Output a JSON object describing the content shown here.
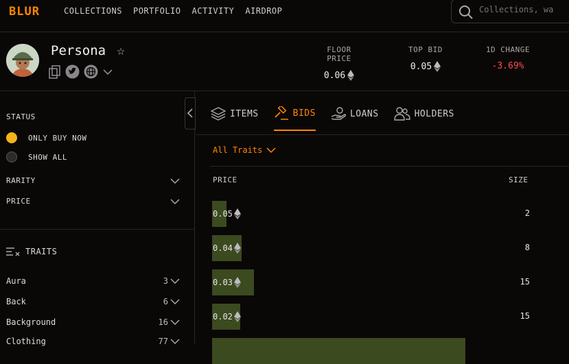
{
  "brand": {
    "logo": "BLUR",
    "accent": "#ff8700"
  },
  "nav": [
    "COLLECTIONS",
    "PORTFOLIO",
    "ACTIVITY",
    "AIRDROP"
  ],
  "search": {
    "placeholder": "Collections, wa"
  },
  "collection": {
    "name": "Persona",
    "stats": [
      {
        "label": "FLOOR PRICE",
        "value": "0.06"
      },
      {
        "label": "TOP BID",
        "value": "0.05"
      },
      {
        "label": "1D CHANGE",
        "value": "-3.69%"
      }
    ]
  },
  "sidebar": {
    "status_title": "STATUS",
    "status_options": [
      {
        "label": "ONLY BUY NOW",
        "selected": true
      },
      {
        "label": "SHOW ALL",
        "selected": false
      }
    ],
    "rarity": "RARITY",
    "price": "PRICE",
    "traits_title": "TRAITS",
    "traits": [
      {
        "label": "Aura",
        "count": "3"
      },
      {
        "label": "Back",
        "count": "6"
      },
      {
        "label": "Background",
        "count": "16"
      },
      {
        "label": "Clothing",
        "count": "77"
      }
    ]
  },
  "tabs": [
    {
      "label": "ITEMS",
      "icon": "layers-icon",
      "active": false
    },
    {
      "label": "BIDS",
      "icon": "gavel-icon",
      "active": true
    },
    {
      "label": "LOANS",
      "icon": "loan-hand-icon",
      "active": false
    },
    {
      "label": "HOLDERS",
      "icon": "users-icon",
      "active": false
    }
  ],
  "bids": {
    "filter": "All Traits",
    "price_header": "PRICE",
    "size_header": "SIZE",
    "rows": [
      {
        "price": "0.05",
        "size": "2",
        "fill": 0.04
      },
      {
        "price": "0.04",
        "size": "8",
        "fill": 0.082
      },
      {
        "price": "0.03",
        "size": "15",
        "fill": 0.118
      },
      {
        "price": "0.02",
        "size": "15",
        "fill": 0.078
      },
      {
        "price": "",
        "size": "",
        "fill": 0.71
      }
    ]
  }
}
